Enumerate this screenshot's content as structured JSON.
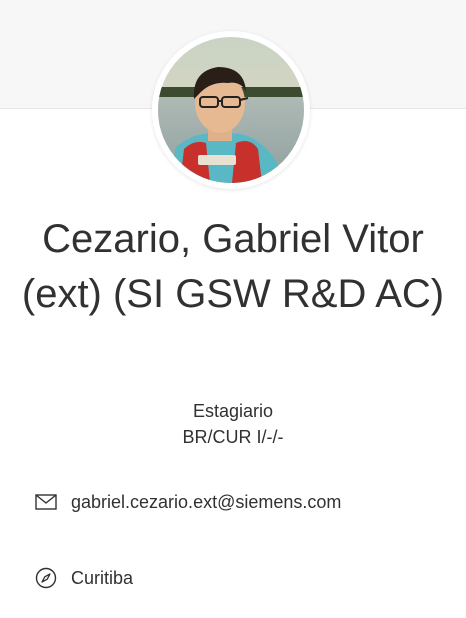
{
  "profile": {
    "name": "Cezario, Gabriel Vitor (ext) (SI GSW R&D AC)",
    "job_title": "Estagiario",
    "department": "BR/CUR I/-/-",
    "avatar_icon": "profile-photo"
  },
  "contact": {
    "email_icon": "mail-icon",
    "email": "gabriel.cezario.ext@siemens.com",
    "location_icon": "compass-icon",
    "location": "Curitiba"
  },
  "colors": {
    "header_band": "#f7f7f7",
    "text": "#323130",
    "background": "#ffffff"
  }
}
